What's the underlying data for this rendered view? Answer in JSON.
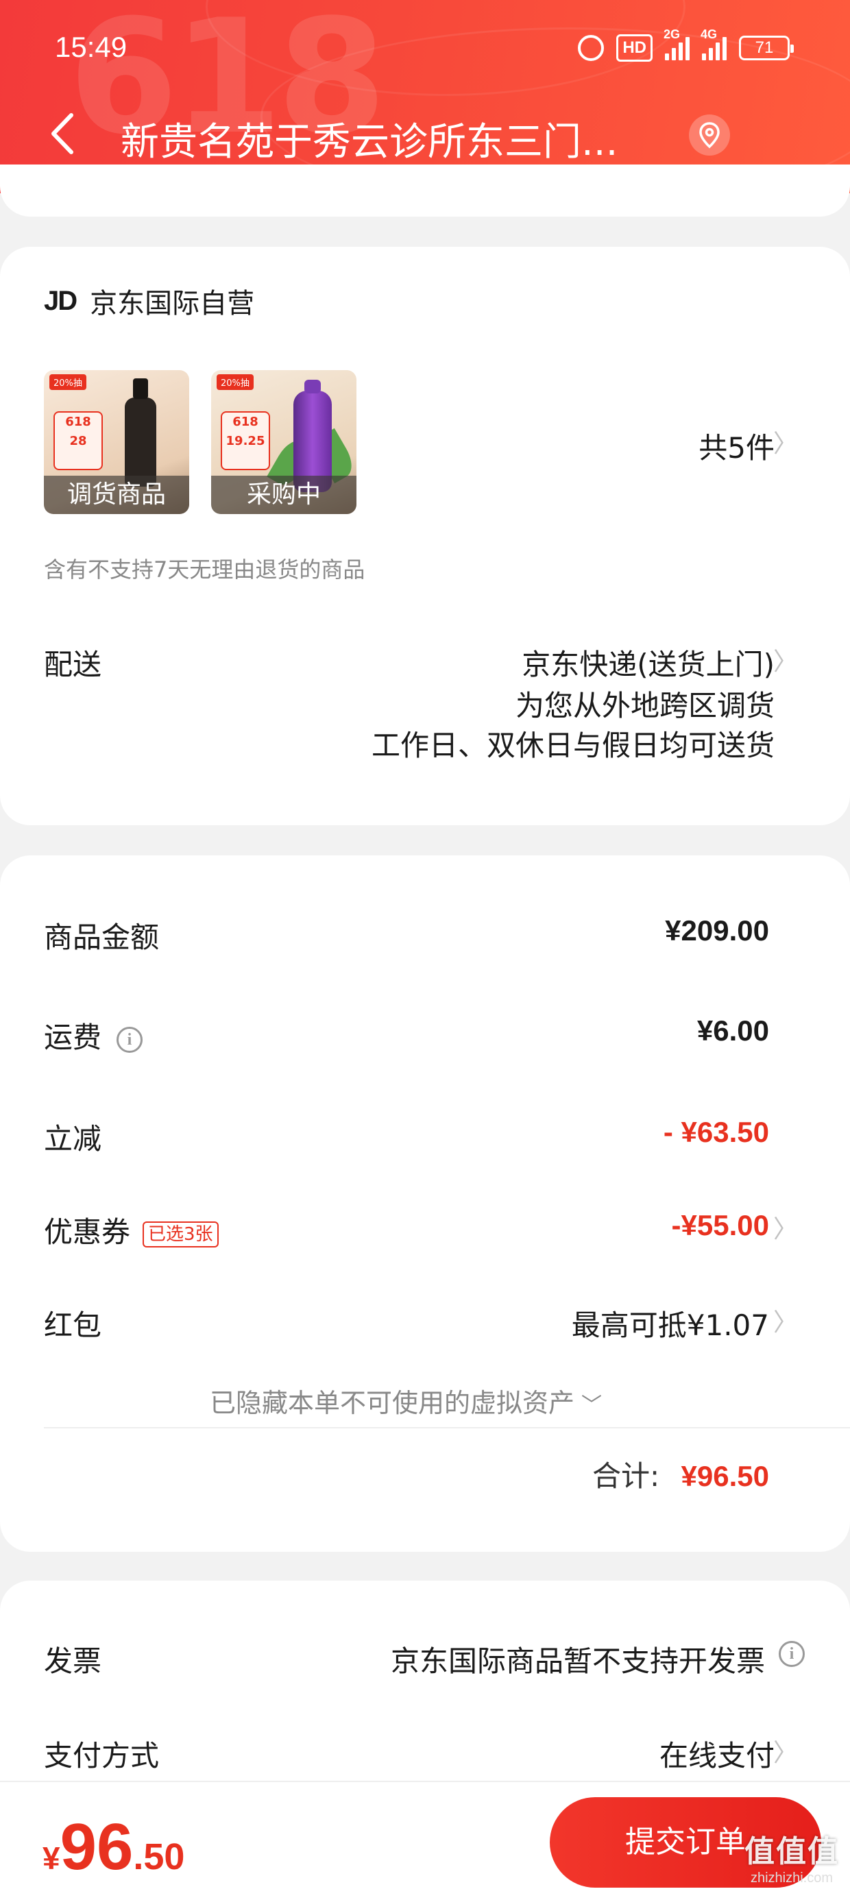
{
  "status_bar": {
    "time": "15:49",
    "hd": "HD",
    "sig1": "2G",
    "sig2": "4G",
    "battery": "71"
  },
  "header": {
    "decoration": "618",
    "title": "新贵名苑于秀云诊所东三门..."
  },
  "shop": {
    "logo": "JD",
    "name": "京东国际自营"
  },
  "products": [
    {
      "caption": "调货商品",
      "tag": "20%抽",
      "price_badge": "28",
      "promo_618": "618"
    },
    {
      "caption": "采购中",
      "tag": "20%抽",
      "price_badge": "19.25",
      "promo_618": "618"
    }
  ],
  "items_count": "共5件",
  "return_notice": "含有不支持7天无理由退货的商品",
  "delivery": {
    "label": "配送",
    "method": "京东快递(送货上门)",
    "line2": "为您从外地跨区调货",
    "line3": "工作日、双休日与假日均可送货"
  },
  "summary": {
    "goods_amount_label": "商品金额",
    "goods_amount": "¥209.00",
    "shipping_label": "运费",
    "shipping": "¥6.00",
    "discount_label": "立减",
    "discount": "- ¥63.50",
    "coupon_label": "优惠券",
    "coupon_badge": "已选3张",
    "coupon": "-¥55.00",
    "redpacket_label": "红包",
    "redpacket": "最高可抵¥1.07",
    "hidden_assets": "已隐藏本单不可使用的虚拟资产",
    "total_label": "合计:",
    "total": "¥96.50"
  },
  "invoice": {
    "label": "发票",
    "value": "京东国际商品暂不支持开发票"
  },
  "payment": {
    "label": "支付方式",
    "value": "在线支付"
  },
  "bottom": {
    "currency": "¥",
    "total_int": "96",
    "total_dec": ".50",
    "submit_label": "提交订单"
  },
  "watermark": {
    "main": "值值值",
    "sub": "zhizhizhi.com"
  },
  "colors": {
    "accent": "#e8311f",
    "header": "#f33a3a"
  }
}
